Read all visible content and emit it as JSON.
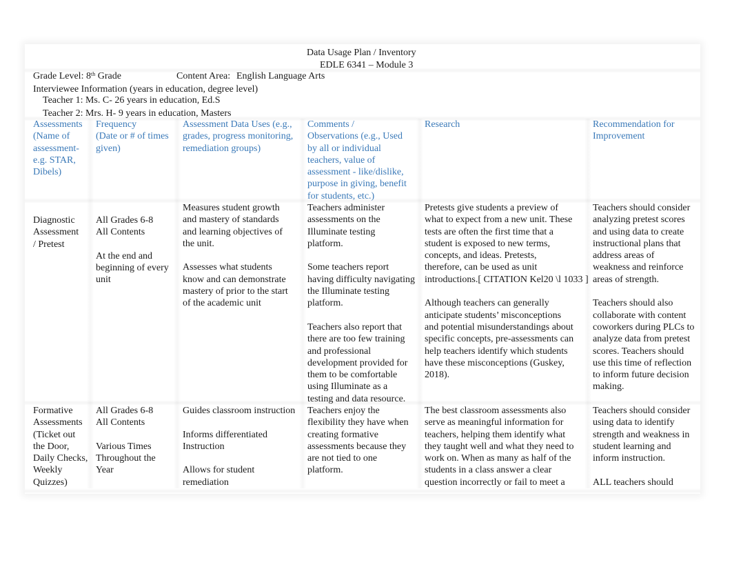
{
  "document": {
    "title": "Data Usage Plan / Inventory",
    "subtitle": "EDLE 6341 – Module 3",
    "grade_level_label": "Grade Level: 8",
    "grade_level_sup": "th",
    "grade_level_suffix": " Grade",
    "content_area_label": "Content Area:",
    "content_area_value": "English Language Arts",
    "interviewee_heading": "Interviewee Information (years in education, degree level)",
    "teacher_1": "Teacher 1: Ms. C- 26 years in education, Ed.S",
    "teacher_2": "Teacher 2: Mrs. H- 9 years in education, Masters",
    "header_color": "#3a79b8"
  },
  "table": {
    "headers": [
      "Assessments\n(Name of\nassessment-\ne.g. STAR,\nDibels)",
      "Frequency\n(Date or # of times\ngiven)",
      "Assessment Data Uses  (e.g.,\ngrades, progress monitoring,\nremediation groups)",
      "Comments /\nObservations  (e.g., Used\nby all or individual\nteachers, value of\nassessment - like/dislike,\npurpose in giving, benefit\nfor students, etc.)",
      "Research",
      "Recommendation for\nImprovement"
    ],
    "rows": [
      {
        "assessment": "Diagnostic\nAssessment\n/ Pretest",
        "frequency": "All Grades 6-8\nAll Contents\n\nAt the end and\nbeginning of every\nunit",
        "data_uses": "Measures student growth\nand mastery of standards\nand learning objectives of\nthe unit.\n\nAssesses what students\nknow and can demonstrate\nmastery of prior to the start\nof the academic unit",
        "comments": "Teachers administer\nassessments on the\nIlluminate testing\nplatform.\n\nSome teachers report\nhaving difficulty navigating\nthe Illuminate testing\nplatform.\n\nTeachers also report that\nthere are too few training\nand professional\ndevelopment provided for\nthem to be comfortable\nusing Illuminate as a\ntesting and data resource.",
        "research": "Pretests give students a preview of\nwhat to expect from a new unit. These\ntests are often the first time that a\nstudent is exposed to new terms,\nconcepts, and ideas. Pretests,\ntherefore, can be used as unit\nintroductions.[ CITATION Kel20 \\l 1033 ]\n\nAlthough teachers can generally\nanticipate students’ misconceptions\nand potential misunderstandings about\nspecific concepts, pre-assessments can\nhelp teachers identify which students\nhave these misconceptions (Guskey,\n2018).",
        "recommendation": "Teachers should consider\nanalyzing pretest scores\nand using data to create\ninstructional plans that\naddress areas of\nweakness and reinforce\nareas of strength.\n\nTeachers should also\ncollaborate with content\ncoworkers during PLCs to\nanalyze data from pretest\nscores. Teachers should\nuse this time of reflection\nto inform future decision\nmaking."
      },
      {
        "assessment": "Formative\nAssessments\n(Ticket out\nthe Door,\nDaily Checks,\nWeekly\nQuizzes)",
        "frequency": "All Grades 6-8\nAll Contents\n\nVarious Times\nThroughout the\nYear",
        "data_uses": "Guides classroom instruction\n\nInforms differentiated\nInstruction\n\nAllows for student\nremediation",
        "comments": "Teachers enjoy the\nflexibility they have when\ncreating formative\nassessments because they\nare not tied to one\nplatform.",
        "research": "The best classroom assessments also\nserve as meaningful information for\nteachers, helping them identify what\nthey taught well and what they need to\nwork on. When as many as half of the\nstudents in a class answer a clear\nquestion incorrectly or fail to meet a",
        "recommendation": "Teachers should consider\nusing data to identify\nstrength and weakness in\nstudent learning and\ninform instruction.\n\nALL teachers should"
      }
    ]
  }
}
